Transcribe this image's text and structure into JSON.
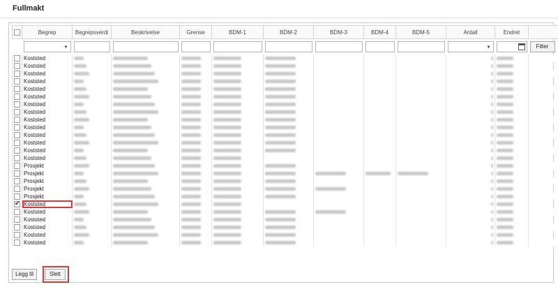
{
  "page_title": "Fullmakt",
  "columns": [
    "Begrep",
    "Begrepsverdi",
    "Beskrivelse",
    "Grense",
    "BDM-1",
    "BDM-2",
    "BDM-3",
    "BDM-4",
    "BDM-5",
    "Antall",
    "Endret"
  ],
  "filter_label": "Filter",
  "rows": [
    {
      "begrep": "Koststed",
      "checked": false
    },
    {
      "begrep": "Koststed",
      "checked": false
    },
    {
      "begrep": "Koststed",
      "checked": false
    },
    {
      "begrep": "Koststed",
      "checked": false
    },
    {
      "begrep": "Koststed",
      "checked": false
    },
    {
      "begrep": "Koststed",
      "checked": false
    },
    {
      "begrep": "Koststed",
      "checked": false
    },
    {
      "begrep": "Koststed",
      "checked": false
    },
    {
      "begrep": "Koststed",
      "checked": false
    },
    {
      "begrep": "Koststed",
      "checked": false
    },
    {
      "begrep": "Koststed",
      "checked": false
    },
    {
      "begrep": "Koststed",
      "checked": false
    },
    {
      "begrep": "Koststed",
      "checked": false
    },
    {
      "begrep": "Koststed",
      "checked": false
    },
    {
      "begrep": "Prosjekt",
      "checked": false
    },
    {
      "begrep": "Prosjekt",
      "checked": false
    },
    {
      "begrep": "Prosjekt",
      "checked": false
    },
    {
      "begrep": "Prosjekt",
      "checked": false
    },
    {
      "begrep": "Prosjekt",
      "checked": false
    },
    {
      "begrep": "Koststed",
      "checked": true
    },
    {
      "begrep": "Koststed",
      "checked": false
    },
    {
      "begrep": "Koststed",
      "checked": false
    },
    {
      "begrep": "Koststed",
      "checked": false
    },
    {
      "begrep": "Koststed",
      "checked": false
    },
    {
      "begrep": "Koststed",
      "checked": false
    }
  ],
  "buttons": {
    "add_label": "Legg til",
    "delete_label": "Slett"
  },
  "colors": {
    "highlight": "#d83a3a",
    "border": "#c9c9c9"
  }
}
